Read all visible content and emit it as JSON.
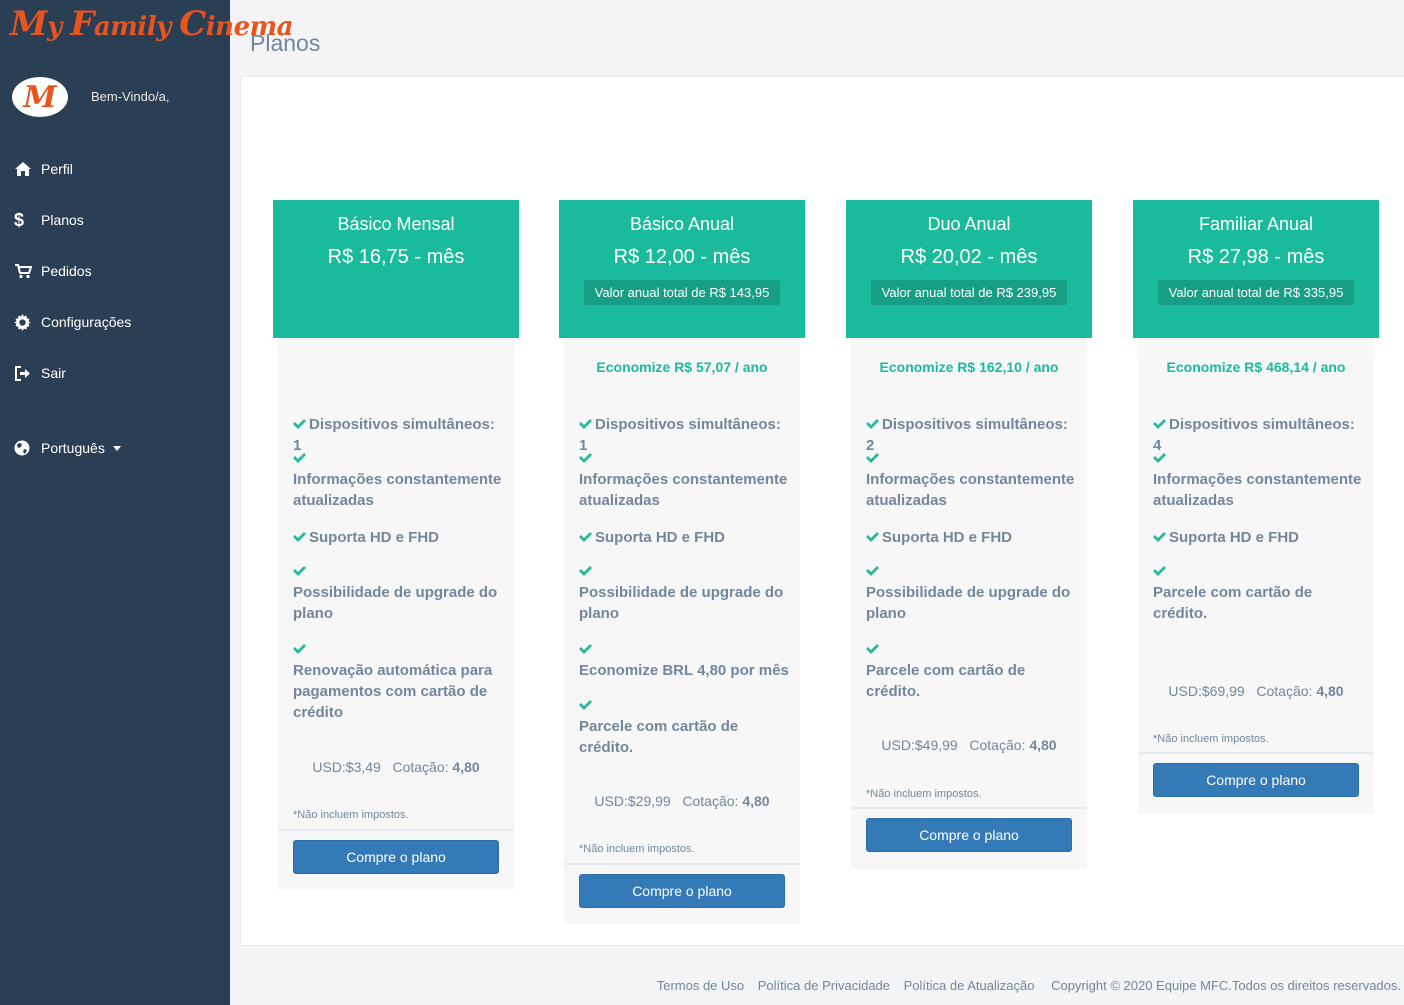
{
  "brand": {
    "logo_text": "My Family Cinema",
    "logo_initial": "M",
    "accent": "#e8541e"
  },
  "sidebar": {
    "welcome": "Bem-Vindo/a,",
    "items": [
      {
        "label": "Perfil",
        "icon": "home-icon"
      },
      {
        "label": "Planos",
        "icon": "dollar-icon"
      },
      {
        "label": "Pedidos",
        "icon": "cart-icon"
      },
      {
        "label": "Configurações",
        "icon": "gear-icon"
      },
      {
        "label": "Sair",
        "icon": "sign-out-icon"
      }
    ],
    "language": {
      "label": "Português",
      "icon": "globe-icon"
    }
  },
  "page": {
    "title": "Planos"
  },
  "plans": [
    {
      "name": "Básico Mensal",
      "price": "R$ 16,75 - mês",
      "annual_total": "",
      "savings": "",
      "features": [
        "Dispositivos simultâneos: 1",
        "Informações constantemente atualizadas",
        "Suporta HD e FHD",
        "Possibilidade de upgrade do plano",
        "Renovação automática para pagamentos com cartão de crédito"
      ],
      "usd": "USD:$3,49",
      "rate_label": "Cotação:",
      "rate_value": "4,80",
      "tax_note": "*Não incluem impostos.",
      "button": "Compre o plano"
    },
    {
      "name": "Básico Anual",
      "price": "R$ 12,00 - mês",
      "annual_total": "Valor anual total de R$ 143,95",
      "savings": "Economize R$ 57,07 / ano",
      "features": [
        "Dispositivos simultâneos: 1",
        "Informações constantemente atualizadas",
        "Suporta HD e FHD",
        "Possibilidade de upgrade do plano",
        "Economize BRL 4,80 por mês",
        "Parcele com cartão de crédito."
      ],
      "usd": "USD:$29,99",
      "rate_label": "Cotação:",
      "rate_value": "4,80",
      "tax_note": "*Não incluem impostos.",
      "button": "Compre o plano"
    },
    {
      "name": "Duo Anual",
      "price": "R$ 20,02 - mês",
      "annual_total": "Valor anual total de R$ 239,95",
      "savings": "Economize R$ 162,10 / ano",
      "features": [
        "Dispositivos simultâneos: 2",
        "Informações constantemente atualizadas",
        "Suporta HD e FHD",
        "Possibilidade de upgrade do plano",
        "Parcele com cartão de crédito."
      ],
      "usd": "USD:$49,99",
      "rate_label": "Cotação:",
      "rate_value": "4,80",
      "tax_note": "*Não incluem impostos.",
      "button": "Compre o plano"
    },
    {
      "name": "Familiar Anual",
      "price": "R$ 27,98 - mês",
      "annual_total": "Valor anual total de R$ 335,95",
      "savings": "Economize R$ 468,14 / ano",
      "features": [
        "Dispositivos simultâneos: 4",
        "Informações constantemente atualizadas",
        "Suporta HD e FHD",
        "Parcele com cartão de crédito."
      ],
      "usd": "USD:$69,99",
      "rate_label": "Cotação:",
      "rate_value": "4,80",
      "tax_note": "*Não incluem impostos.",
      "button": "Compre o plano"
    }
  ],
  "footer": {
    "links": [
      "Termos de Uso",
      "Política de Privacidade",
      "Política de Atualização"
    ],
    "copyright": "Copyright © 2020 Equipe MFC.Todos os direitos reservados."
  }
}
